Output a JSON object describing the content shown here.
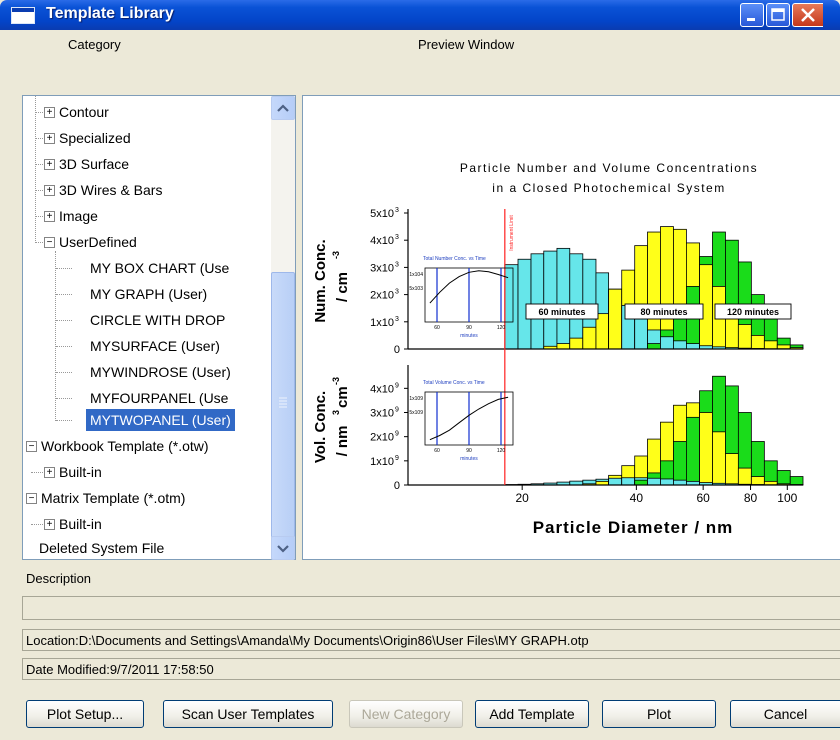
{
  "window": {
    "title": "Template Library"
  },
  "labels": {
    "category": "Category",
    "preview": "Preview Window",
    "description": "Description"
  },
  "tree": {
    "contour": "Contour",
    "specialized": "Specialized",
    "surface3d": "3D Surface",
    "wires3d": "3D Wires & Bars",
    "image": "Image",
    "userdefined": "UserDefined",
    "user_items": [
      "MY BOX CHART (Use",
      "MY GRAPH (User)",
      "CIRCLE WITH DROP",
      "MYSURFACE (User)",
      "MYWINDROSE (User)",
      "MYFOURPANEL (Use",
      "MYTWOPANEL (User)"
    ],
    "workbook": "Workbook Template (*.otw)",
    "workbook_builtin": "Built-in",
    "matrix": "Matrix Template (*.otm)",
    "matrix_builtin": "Built-in",
    "deleted": "Deleted System File"
  },
  "status": {
    "location": "Location:D:\\Documents and Settings\\Amanda\\My Documents\\Origin86\\User Files\\MY GRAPH.otp",
    "date_modified": "Date Modified:9/7/2011 17:58:50"
  },
  "buttons": {
    "plot_setup": "Plot Setup...",
    "scan_user": "Scan User Templates",
    "new_category": "New Category",
    "add_template": "Add Template",
    "plot": "Plot",
    "cancel": "Cancel"
  },
  "colors": {
    "selection": "#3169c6",
    "cyan": "#66e6ea",
    "yellow": "#ffff19",
    "green": "#1adc1a",
    "marker_line": "#ff2020"
  },
  "chart_data": {
    "type": "bar",
    "title": "Particle Number and Volume Concentrations",
    "subtitle": "in a Closed Photochemical System",
    "xlabel": "Particle Diameter / nm",
    "x_scale": "log",
    "x_ticks": [
      "20",
      "40",
      "60",
      "80",
      "100"
    ],
    "x_tick_values": [
      20,
      40,
      60,
      80,
      100
    ],
    "xlim": [
      10,
      110
    ],
    "marker_label": "Instrument Limit",
    "marker_x": 18,
    "series_names": [
      "60 minutes",
      "80 minutes",
      "120 minutes"
    ],
    "panels": [
      {
        "ylabel_line1": "Num. Conc.",
        "ylabel_line2": "/ cm",
        "ylabel_exp": "-3",
        "y_ticks": [
          {
            "value": 0,
            "label": "0",
            "exp": ""
          },
          {
            "value": 1,
            "label": "1x10",
            "exp": "3"
          },
          {
            "value": 2,
            "label": "2x10",
            "exp": "3"
          },
          {
            "value": 3,
            "label": "3x10",
            "exp": "3"
          },
          {
            "value": 4,
            "label": "4x10",
            "exp": "3"
          },
          {
            "value": 5,
            "label": "5x10",
            "exp": "3"
          }
        ],
        "ylim": [
          0,
          5
        ],
        "bin_edges": [
          18.0,
          19.5,
          21.1,
          22.8,
          24.7,
          26.7,
          28.9,
          31.3,
          33.8,
          36.6,
          39.6,
          42.8,
          46.3,
          50.1,
          54.2,
          58.7,
          63.5,
          68.7,
          74.3,
          80.4,
          87.0,
          94.1,
          101.8,
          110.0
        ],
        "series": [
          {
            "name": "60 minutes",
            "values": [
              3.1,
              3.3,
              3.5,
              3.6,
              3.7,
              3.5,
              3.3,
              2.8,
              2.2,
              1.6,
              1.1,
              0.7,
              0.45,
              0.3,
              0.2,
              0.12,
              0.08,
              0.05,
              0.03,
              0.02,
              0.01,
              0.01,
              0.0
            ]
          },
          {
            "name": "80 minutes",
            "values": [
              0.0,
              0.0,
              0.0,
              0.1,
              0.2,
              0.4,
              0.8,
              1.3,
              2.2,
              2.9,
              3.8,
              4.3,
              4.5,
              4.4,
              3.9,
              3.1,
              2.3,
              1.5,
              0.9,
              0.5,
              0.3,
              0.15,
              0.05
            ]
          },
          {
            "name": "120 minutes",
            "values": [
              0.0,
              0.0,
              0.0,
              0.0,
              0.0,
              0.0,
              0.0,
              0.0,
              0.0,
              0.0,
              0.0,
              0.2,
              0.7,
              1.3,
              2.3,
              3.4,
              4.3,
              4.0,
              3.2,
              2.0,
              1.1,
              0.4,
              0.15
            ]
          }
        ]
      },
      {
        "ylabel_line1": "Vol. Conc.",
        "ylabel_line2": "/ nm",
        "ylabel_line2_b": "cm",
        "ylabel_exp_a": "3",
        "ylabel_exp": "-3",
        "y_ticks": [
          {
            "value": 0,
            "label": "0",
            "exp": ""
          },
          {
            "value": 1,
            "label": "1x10",
            "exp": "9"
          },
          {
            "value": 2,
            "label": "2x10",
            "exp": "9"
          },
          {
            "value": 3,
            "label": "3x10",
            "exp": "9"
          },
          {
            "value": 4,
            "label": "4x10",
            "exp": "9"
          }
        ],
        "ylim": [
          0,
          4.8
        ],
        "bin_edges": [
          18.0,
          19.5,
          21.1,
          22.8,
          24.7,
          26.7,
          28.9,
          31.3,
          33.8,
          36.6,
          39.6,
          42.8,
          46.3,
          50.1,
          54.2,
          58.7,
          63.5,
          68.7,
          74.3,
          80.4,
          87.0,
          94.1,
          101.8,
          110.0
        ],
        "series": [
          {
            "name": "60 minutes",
            "values": [
              0.02,
              0.03,
              0.05,
              0.08,
              0.12,
              0.16,
              0.2,
              0.24,
              0.28,
              0.3,
              0.3,
              0.28,
              0.25,
              0.2,
              0.15,
              0.1,
              0.07,
              0.05,
              0.03,
              0.02,
              0.01,
              0.01,
              0.0
            ]
          },
          {
            "name": "80 minutes",
            "values": [
              0.0,
              0.0,
              0.0,
              0.0,
              0.0,
              0.0,
              0.05,
              0.15,
              0.4,
              0.8,
              1.2,
              1.9,
              2.6,
              3.3,
              3.4,
              3.0,
              2.2,
              1.3,
              0.7,
              0.35,
              0.15,
              0.05,
              0.02
            ]
          },
          {
            "name": "120 minutes",
            "values": [
              0.0,
              0.0,
              0.0,
              0.0,
              0.0,
              0.0,
              0.0,
              0.0,
              0.0,
              0.0,
              0.2,
              0.5,
              1.0,
              1.8,
              2.8,
              3.9,
              4.5,
              4.1,
              3.0,
              1.8,
              1.0,
              0.6,
              0.35
            ]
          }
        ]
      }
    ],
    "insets": [
      {
        "title": "Total Number Conc. vs Time",
        "xlabel": "minutes",
        "x_ticks": [
          "60",
          "90",
          "120"
        ],
        "y_ticks": [
          "1x10",
          "5x10"
        ],
        "y_tick_exp": [
          "4",
          "3"
        ],
        "curve": [
          [
            45,
            0.35
          ],
          [
            55,
            0.55
          ],
          [
            65,
            0.72
          ],
          [
            75,
            0.84
          ],
          [
            85,
            0.92
          ],
          [
            95,
            0.95
          ],
          [
            105,
            0.93
          ],
          [
            115,
            0.88
          ],
          [
            125,
            0.82
          ]
        ]
      },
      {
        "title": "Total Volume Conc. vs Time",
        "xlabel": "minutes",
        "x_ticks": [
          "60",
          "90",
          "120"
        ],
        "y_ticks": [
          "1x10",
          "5x10"
        ],
        "y_tick_exp": [
          "9",
          "9"
        ],
        "curve": [
          [
            45,
            0.1
          ],
          [
            55,
            0.18
          ],
          [
            65,
            0.28
          ],
          [
            75,
            0.42
          ],
          [
            85,
            0.56
          ],
          [
            95,
            0.68
          ],
          [
            105,
            0.78
          ],
          [
            115,
            0.86
          ],
          [
            125,
            0.9
          ]
        ]
      }
    ]
  }
}
